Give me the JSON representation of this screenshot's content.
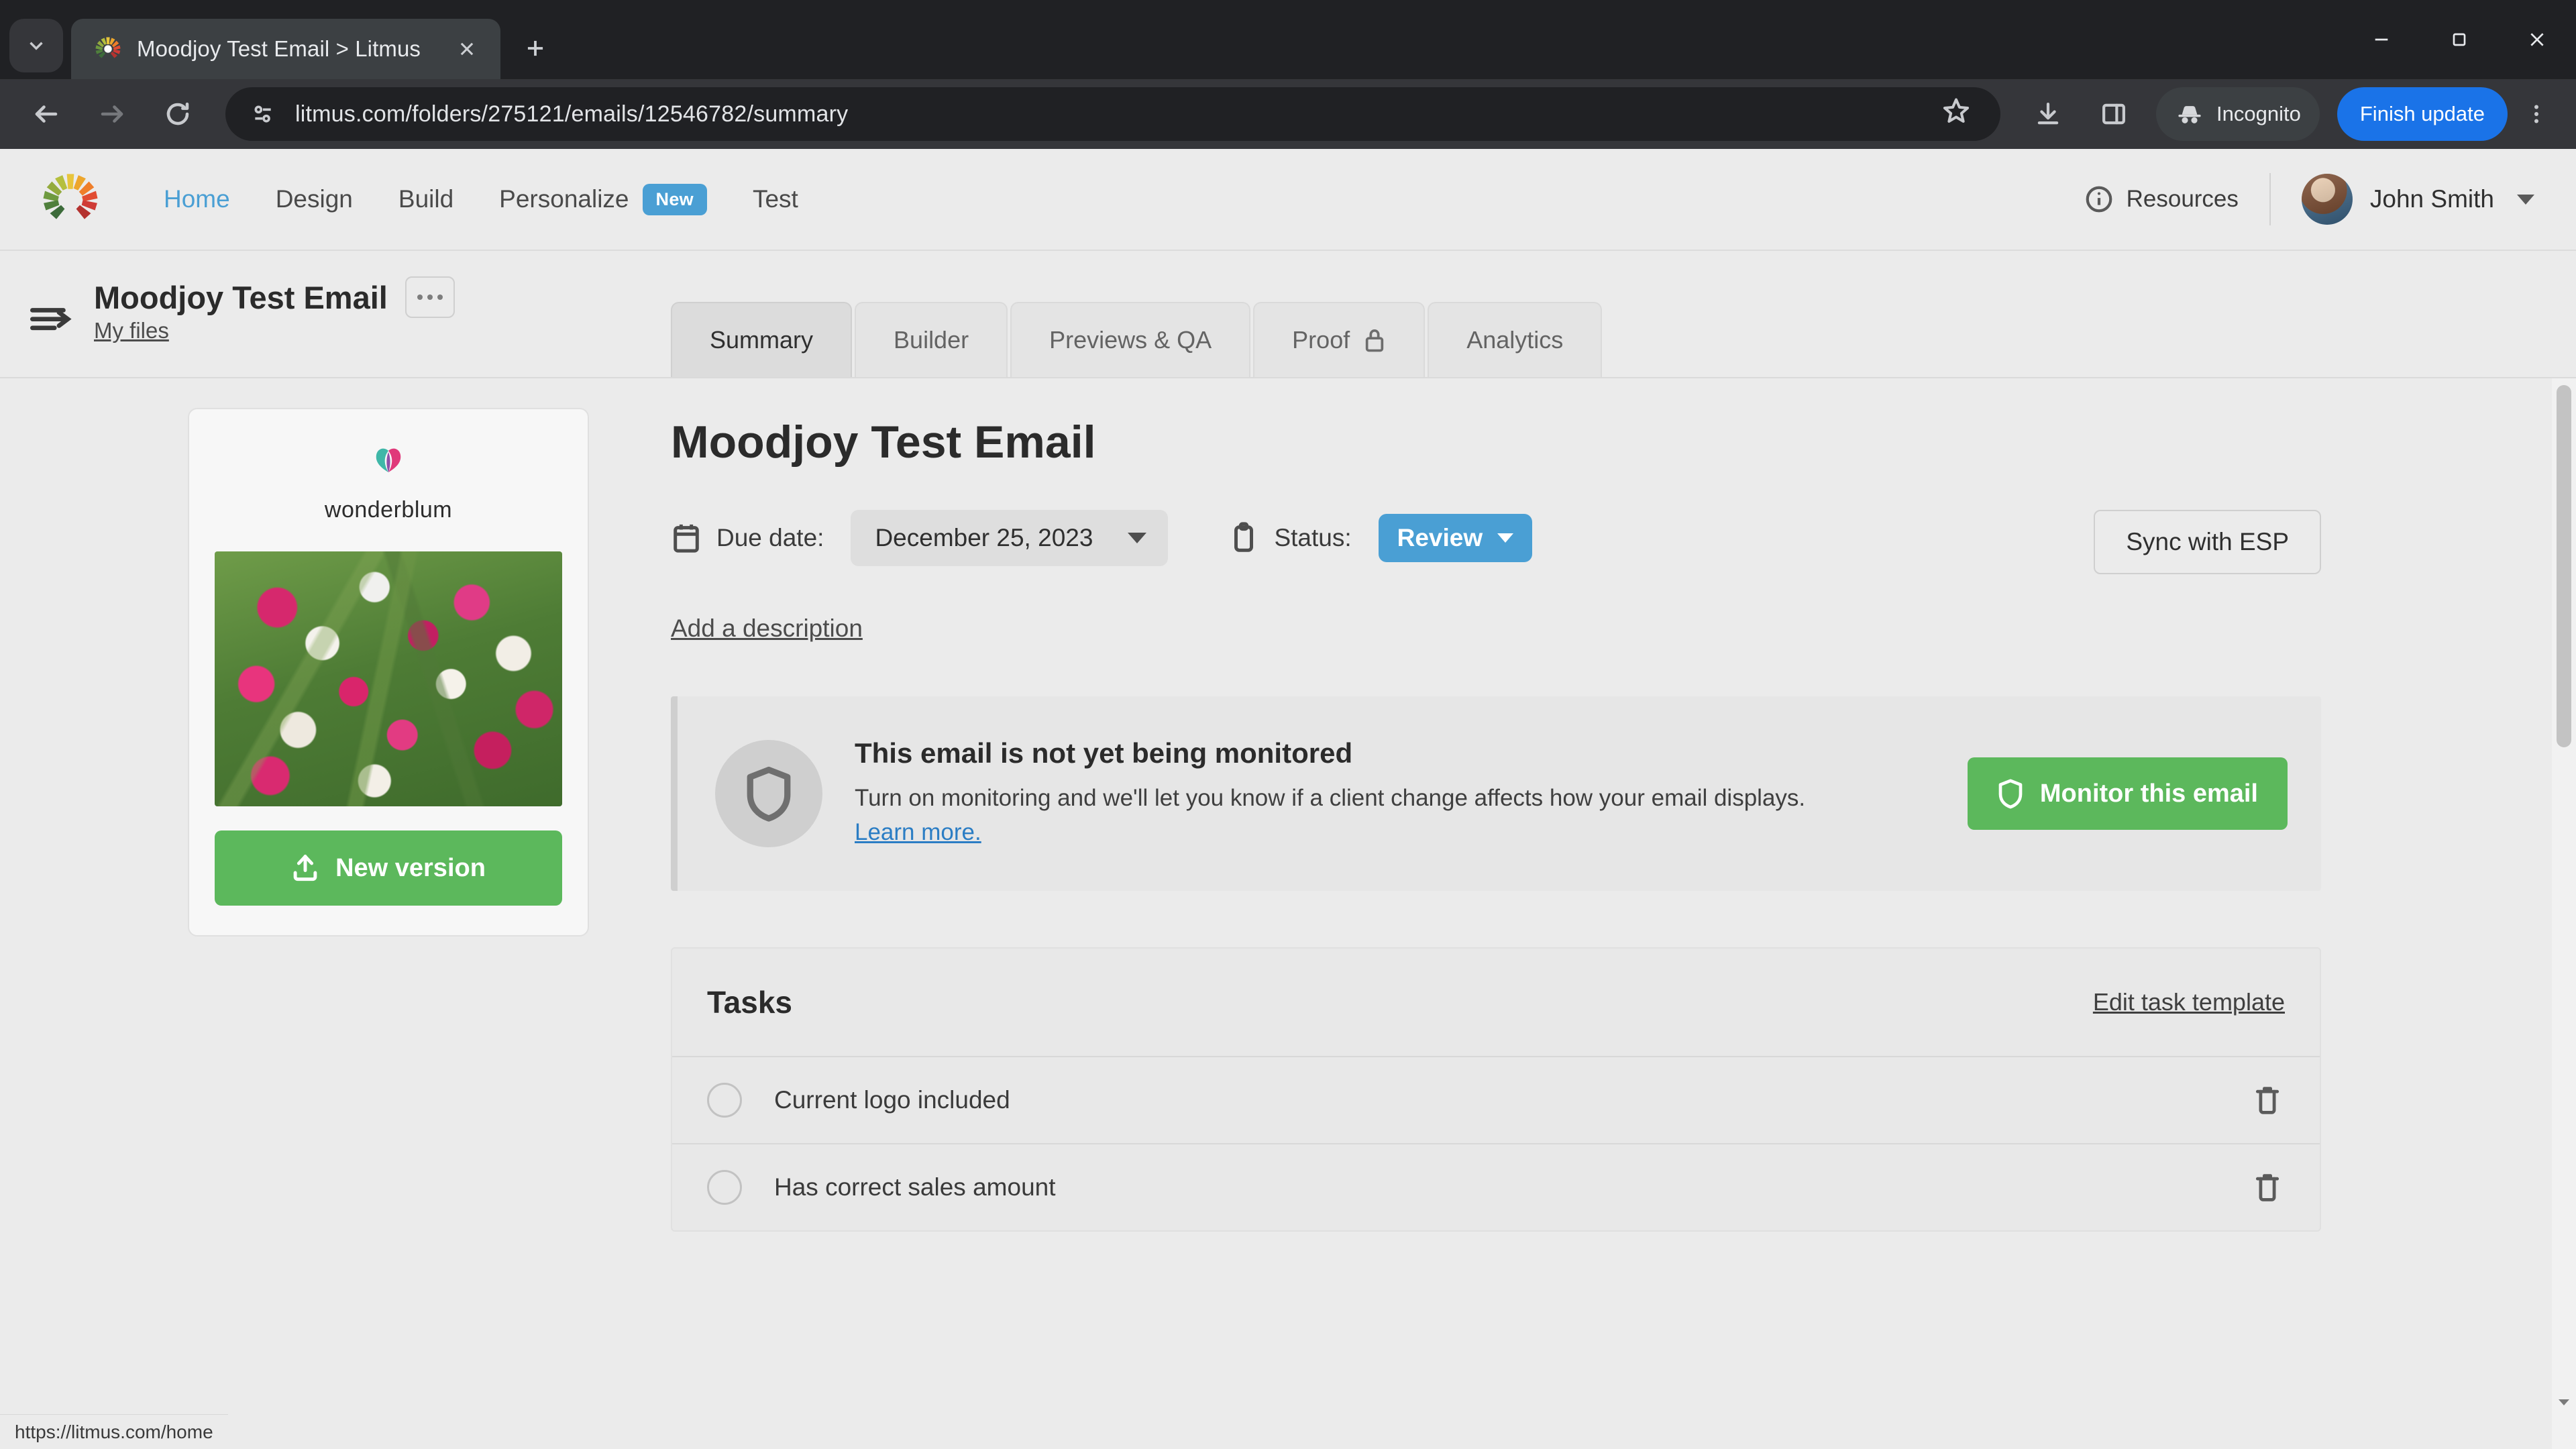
{
  "browser": {
    "tab": {
      "title": "Moodjoy Test Email > Litmus",
      "favicon": "litmus-pinwheel-icon",
      "close_label": "Close tab"
    },
    "new_tab_label": "New tab",
    "tab_search_label": "Search tabs",
    "window": {
      "minimize": "Minimize",
      "maximize": "Restore",
      "close": "Close"
    },
    "nav": {
      "back": "Back",
      "forward": "Forward",
      "reload": "Reload"
    },
    "omnibox": {
      "url": "litmus.com/folders/275121/emails/12546782/summary",
      "site_info_icon": "page-settings-icon",
      "bookmark_icon": "star-icon"
    },
    "downloads_label": "Downloads",
    "side_panel_label": "Side panel",
    "incognito": {
      "label": "Incognito",
      "icon": "incognito-hat-icon"
    },
    "finish_update_label": "Finish update",
    "menu_label": "Customize and control"
  },
  "app": {
    "logo": "litmus-pinwheel-logo",
    "nav": [
      {
        "label": "Home",
        "active": true,
        "badge": null
      },
      {
        "label": "Design",
        "active": false,
        "badge": null
      },
      {
        "label": "Build",
        "active": false,
        "badge": null
      },
      {
        "label": "Personalize",
        "active": false,
        "badge": "New"
      },
      {
        "label": "Test",
        "active": false,
        "badge": null
      }
    ],
    "resources": {
      "label": "Resources",
      "icon": "info-circle-icon"
    },
    "user": {
      "name": "John Smith",
      "avatar": "user-avatar"
    }
  },
  "filebar": {
    "collapse_icon": "collapse-sidebar-icon",
    "title": "Moodjoy Test Email",
    "more_label": "More options",
    "breadcrumb": "My files",
    "tabs": [
      {
        "label": "Summary",
        "active": true,
        "icon": null
      },
      {
        "label": "Builder",
        "active": false,
        "icon": null
      },
      {
        "label": "Previews & QA",
        "active": false,
        "icon": null
      },
      {
        "label": "Proof",
        "active": false,
        "icon": "lock-icon"
      },
      {
        "label": "Analytics",
        "active": false,
        "icon": null
      }
    ]
  },
  "preview": {
    "brand_name": "wonderblum",
    "brand_mark": "tulip-icon",
    "thumbnail_alt": "Tulip bouquet email preview",
    "new_version_label": "New version",
    "new_version_icon": "upload-icon"
  },
  "main": {
    "page_title": "Moodjoy Test Email",
    "due_date": {
      "icon": "calendar-icon",
      "label": "Due date:",
      "value": "December 25, 2023"
    },
    "status": {
      "icon": "clipboard-icon",
      "label": "Status:",
      "value": "Review",
      "color": "#4a9fd4"
    },
    "sync_label": "Sync with ESP",
    "add_description_label": "Add a description",
    "monitor": {
      "icon": "shield-icon",
      "title": "This email is not yet being monitored",
      "body_before": "Turn on monitoring and we'll let you know if a client change affects how your email displays. ",
      "link": "Learn more.",
      "button_label": "Monitor this email",
      "button_icon": "shield-icon",
      "button_color": "#5cb85c"
    },
    "tasks": {
      "title": "Tasks",
      "edit_label": "Edit task template",
      "items": [
        {
          "label": "Current logo included",
          "checked": false,
          "delete_icon": "trash-icon"
        },
        {
          "label": "Has correct sales amount",
          "checked": false,
          "delete_icon": "trash-icon"
        }
      ]
    }
  },
  "status_bar": {
    "link_preview": "https://litmus.com/home"
  }
}
